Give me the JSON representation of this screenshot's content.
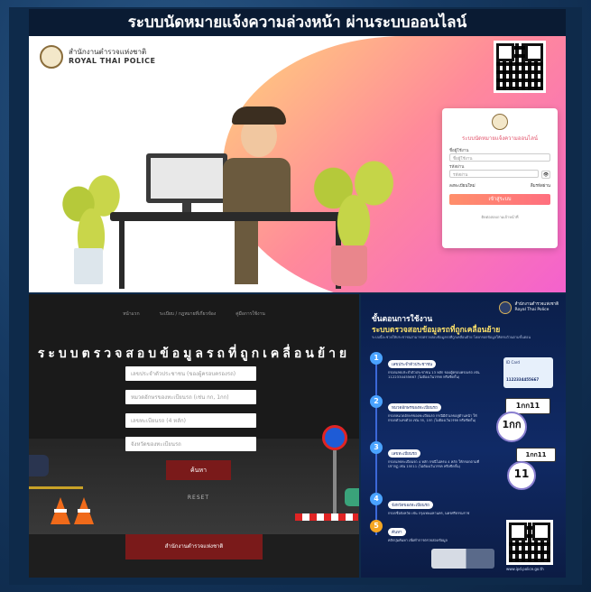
{
  "top": {
    "banner_title": "ระบบนัดหมายแจ้งความล่วงหน้า ผ่านระบบออนไลน์",
    "logo_th": "สำนักงานตำรวจแห่งชาติ",
    "logo_en": "ROYAL THAI POLICE",
    "login": {
      "title": "ระบบนัดหมายแจ้งความออนไลน์",
      "username_label": "ชื่อผู้ใช้งาน",
      "username_placeholder": "ชื่อผู้ใช้งาน",
      "password_label": "รหัสผ่าน",
      "password_placeholder": "รหัสผ่าน",
      "register_link": "ลงทะเบียนใหม่",
      "forgot_link": "ลืมรหัสผ่าน",
      "submit_label": "เข้าสู่ระบบ",
      "footer_text": "ติดต่อสอบถามเจ้าหน้าที่"
    }
  },
  "bottom_left": {
    "nav": [
      "หน้าแรก",
      "ระเบียบ / กฎหมายที่เกี่ยวข้อง",
      "คู่มือการใช้งาน"
    ],
    "title": "ระบบตรวจสอบข้อมูลรถที่ถูกเคลื่อนย้าย",
    "fields": [
      "เลขประจำตัวประชาชน (ของผู้ครอบครองรถ)",
      "หมวดอักษรของทะเบียนรถ (เช่น กก, 1กก)",
      "เลขทะเบียนรถ (4 หลัก)",
      "จังหวัดของทะเบียนรถ"
    ],
    "search_label": "ค้นหา",
    "reset_label": "RESET",
    "footer_label": "สำนักงานตำรวจแห่งชาติ"
  },
  "bottom_right": {
    "logo_th": "สำนักงานตำรวจแห่งชาติ",
    "logo_en": "Royal Thai Police",
    "heading1": "ขั้นตอนการใช้งาน",
    "heading2": "ระบบตรวจสอบข้อมูลรถที่ถูกเคลื่อนย้าย",
    "subtext": "ระบบนี้จะช่วยให้ประชาชนสามารถตรวจสอบข้อมูลรถที่ถูกเคลื่อนย้าย โดยกรอกข้อมูลให้ครบถ้วนตามขั้นตอน",
    "steps": [
      {
        "num": "1",
        "pill": "เลขประจำตัวประชาชน",
        "text": "กรอกเลขประจำตัวประชาชน 13 หลัก ของผู้ครอบครองรถ เช่น 1122334455667 (ไม่ต้องเว้นวรรค หรือขีดกั้น)"
      },
      {
        "num": "2",
        "pill": "หมวดอักษรของทะเบียนรถ",
        "text": "กรอกหมวดอักษรของทะเบียนรถ กรณีมีตัวเลขอยู่ด้านหน้า ให้กรอกตัวเลขด้วย เช่น กก, 1กก (ไม่ต้องเว้นวรรค หรือขีดกั้น)"
      },
      {
        "num": "3",
        "pill": "เลขทะเบียนรถ",
        "text": "กรอกเลขทะเบียนรถ 4 หลัก กรณีไม่ครบ 4 หลัก ให้กรอกตามที่ปรากฏ เช่น 1กก11 (ไม่ต้องเว้นวรรค หรือขีดกั้น)"
      },
      {
        "num": "4",
        "pill": "จังหวัดของทะเบียนรถ",
        "text": "กรอกชื่อจังหวัด เช่น กรุงเทพมหานคร, นครศรีธรรมราช"
      },
      {
        "num": "5",
        "pill": "ค้นหา",
        "text": "คลิกปุ่มค้นหา เพื่อทำการตรวจสอบข้อมูล"
      }
    ],
    "id_card_label": "ID Card",
    "id_card_number": "1122334455667",
    "plate1": "1กก11",
    "circle1_big": "1กก",
    "circle1_small": "หมวดอักษร",
    "plate2": "1กก11",
    "circle2_big": "11",
    "circle2_small": "เลขทะเบียน",
    "url": "www.ipd.police.go.th",
    "colors": {
      "step1": "#4aa3ff",
      "step2": "#4aa3ff",
      "step3": "#4aa3ff",
      "step4": "#4aa3ff",
      "step5": "#f5a623"
    }
  }
}
